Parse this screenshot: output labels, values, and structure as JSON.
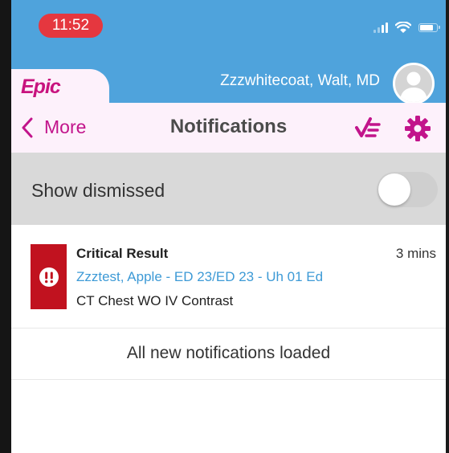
{
  "status_bar": {
    "time": "11:52",
    "time_pill_color": "#e5373f",
    "icons": [
      "signal-icon",
      "wifi-icon",
      "battery-icon"
    ]
  },
  "header": {
    "logo": "Epic",
    "provider_name": "Zzzwhitecoat, Walt, MD",
    "avatar_icon": "user-avatar-icon",
    "background_color": "#4fa3dc"
  },
  "nav": {
    "back_label": "More",
    "title": "Notifications",
    "filter_icon": "filter-icon",
    "settings_icon": "gear-icon",
    "accent_color": "#c2148b"
  },
  "dismissed": {
    "label": "Show dismissed",
    "toggle_on": false
  },
  "notifications": [
    {
      "type_icon": "critical-result-icon",
      "title": "Critical Result",
      "time": "3 mins",
      "patient": "Zzztest, Apple - ED 23/ED 23 - Uh 01 Ed",
      "description": "CT Chest WO IV Contrast"
    }
  ],
  "footer_message": "All new notifications loaded"
}
